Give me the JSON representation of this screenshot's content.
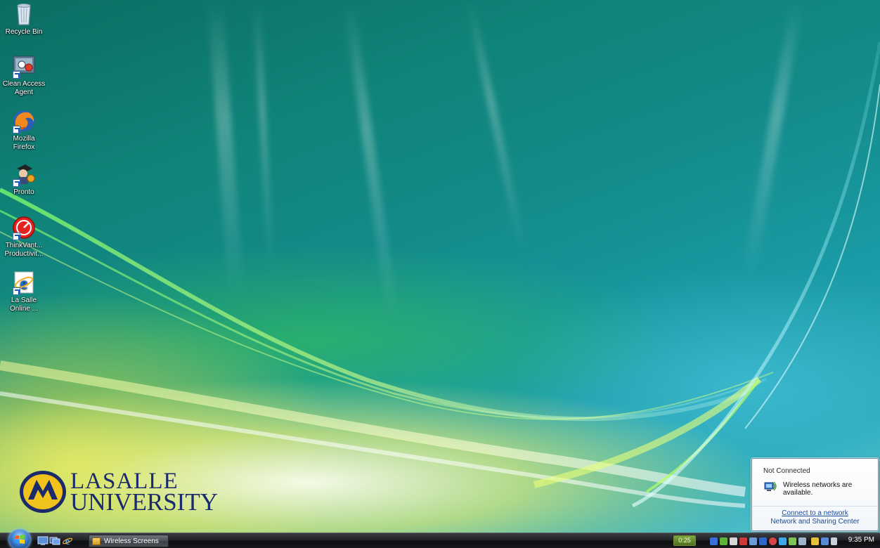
{
  "desktop": {
    "icons": [
      {
        "label": "Recycle Bin",
        "icon": "recycle-bin-icon"
      },
      {
        "label": "Clean Access Agent",
        "icon": "clean-access-agent-icon"
      },
      {
        "label": "Mozilla Firefox",
        "icon": "firefox-icon"
      },
      {
        "label": "Pronto",
        "icon": "pronto-icon"
      },
      {
        "label": "ThinkVant... Productivit...",
        "icon": "thinkvantage-icon"
      },
      {
        "label": "La Salle Online ...",
        "icon": "internet-explorer-icon"
      }
    ],
    "logo": {
      "line1": "LASALLE",
      "line2": "UNIVERSITY",
      "color": "#1a2a6a"
    }
  },
  "notification": {
    "title": "Not Connected",
    "message": "Wireless networks are available.",
    "link_connect": "Connect to a network",
    "link_sharing": "Network and Sharing Center"
  },
  "taskbar": {
    "quick_launch": [
      "show-desktop-icon",
      "switch-windows-icon",
      "internet-explorer-icon"
    ],
    "open_window": "Wireless Screens",
    "timer": "0:25",
    "clock": "9:35 PM"
  },
  "colors": {
    "accent_blue": "#1a4f9c",
    "taskbar": "#1e1f22"
  }
}
